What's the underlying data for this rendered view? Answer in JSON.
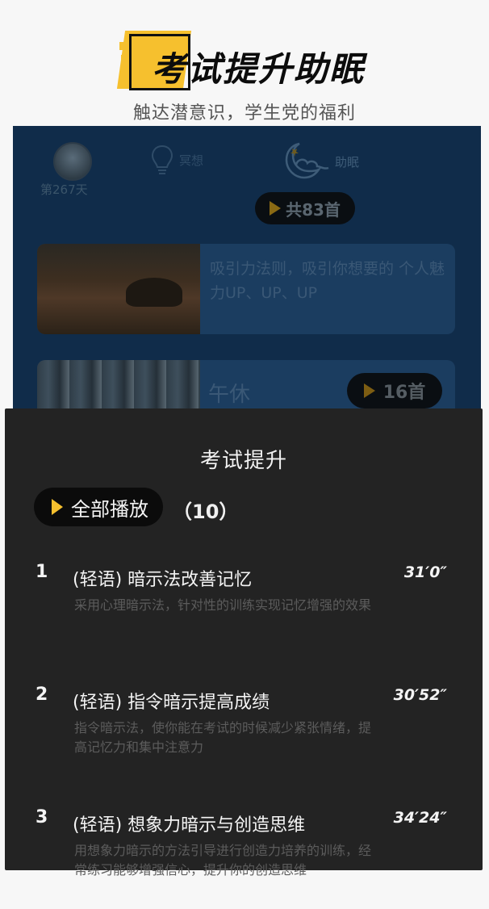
{
  "banner": {
    "headline": "考试提升助眠",
    "subhead": "触达潜意识，学生党的福利",
    "accent_color": "#f6c02e"
  },
  "screen": {
    "profile": {
      "day_label": "第267天"
    },
    "tabs": [
      {
        "label": "冥想",
        "icon": "lightbulb-icon"
      },
      {
        "label": "助眠",
        "icon": "moon-cloud-icon"
      }
    ],
    "total_count": "共83首",
    "cards": [
      {
        "title": "吸引力法则，吸引你想要的 个人魅力UP、UP、UP"
      },
      {
        "title": "午休",
        "count": "16首"
      }
    ]
  },
  "sheet": {
    "title": "考试提升",
    "play_all_label": "全部播放",
    "play_all_count": "（10）",
    "tracks": [
      {
        "num": "1",
        "title": "(轻语) 暗示法改善记忆",
        "duration": "31′0″",
        "desc": "采用心理暗示法，针对性的训练实现记忆增强的效果"
      },
      {
        "num": "2",
        "title": "(轻语) 指令暗示提高成绩",
        "duration": "30′52″",
        "desc": "指令暗示法，使你能在考试的时候减少紧张情绪，提高记忆力和集中注意力"
      },
      {
        "num": "3",
        "title": "(轻语) 想象力暗示与创造思维",
        "duration": "34′24″",
        "desc": "用想象力暗示的方法引导进行创造力培养的训练，经常练习能够增强信心，提升你的创造思维"
      }
    ]
  }
}
